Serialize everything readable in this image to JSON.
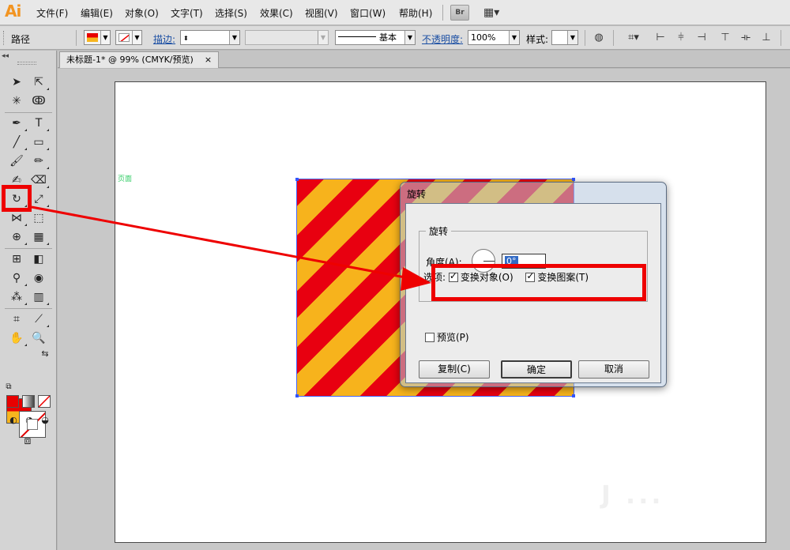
{
  "app": {
    "logo": "Ai"
  },
  "menu": {
    "items": [
      "文件(F)",
      "编辑(E)",
      "对象(O)",
      "文字(T)",
      "选择(S)",
      "效果(C)",
      "视图(V)",
      "窗口(W)",
      "帮助(H)"
    ],
    "bridge_button": "Br"
  },
  "control_bar": {
    "title": "路径",
    "stroke_link": "描边:",
    "stroke_style": "基本",
    "opacity_link": "不透明度:",
    "opacity_value": "100%",
    "style_label": "样式:"
  },
  "document": {
    "tab_title": "未标题-1* @ 99% (CMYK/预览)",
    "close": "×"
  },
  "canvas": {
    "artboard_label": "页面"
  },
  "dialog": {
    "title": "旋转",
    "group_title": "旋转",
    "angle_label": "角度(A):",
    "angle_value": "0°",
    "options_label": "选项:",
    "transform_objects": "变换对象(O)",
    "transform_patterns": "变换图案(T)",
    "preview": "预览(P)",
    "copy_button": "复制(C)",
    "ok_button": "确定",
    "cancel_button": "取消",
    "transform_objects_checked": true,
    "transform_patterns_checked": true,
    "preview_checked": false
  },
  "colors": {
    "stripe_red": "#e80010",
    "stripe_yellow": "#f7b31c",
    "annotation_red": "#ee0000",
    "logo_orange": "#f29421"
  }
}
